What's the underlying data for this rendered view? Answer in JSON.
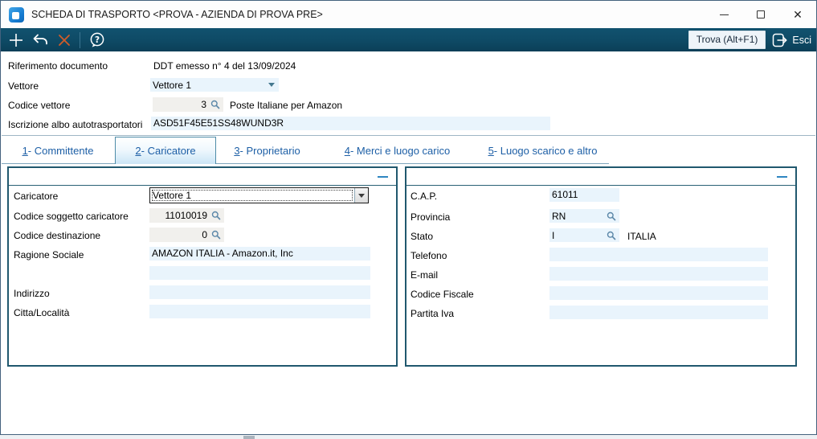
{
  "window": {
    "title": "SCHEDA DI TRASPORTO <PROVA - AZIENDA DI PROVA PRE>"
  },
  "toolbar": {
    "trova_label": "Trova (Alt+F1)",
    "esci_label": "Esci"
  },
  "header": {
    "riferimento": {
      "label": "Riferimento documento",
      "value": "DDT emesso n° 4 del 13/09/2024"
    },
    "vettore": {
      "label": "Vettore",
      "value": "Vettore 1"
    },
    "codice_vettore": {
      "label": "Codice vettore",
      "value": "3",
      "desc": "Poste Italiane per Amazon"
    },
    "iscrizione": {
      "label": "Iscrizione albo autotrasportatori",
      "value": "ASD51F45E51SS48WUND3R"
    }
  },
  "tabs": [
    {
      "num": "1",
      "rest": " - Committente"
    },
    {
      "num": "2",
      "rest": " - Caricatore"
    },
    {
      "num": "3",
      "rest": " - Proprietario"
    },
    {
      "num": "4",
      "rest": " - Merci e luogo carico"
    },
    {
      "num": "5",
      "rest": " - Luogo scarico e altro"
    }
  ],
  "caricatore_panel": {
    "caricatore": {
      "label": "Caricatore",
      "value": "Vettore 1"
    },
    "codice_soggetto": {
      "label": "Codice soggetto caricatore",
      "value": "11010019"
    },
    "codice_destinazione": {
      "label": "Codice destinazione",
      "value": "0"
    },
    "ragione_sociale": {
      "label": "Ragione Sociale",
      "value": "AMAZON ITALIA - Amazon.it, Inc",
      "value2": ""
    },
    "indirizzo": {
      "label": "Indirizzo",
      "value": ""
    },
    "citta": {
      "label": "Citta/Località",
      "value": ""
    }
  },
  "dettagli_panel": {
    "cap": {
      "label": "C.A.P.",
      "value": "61011"
    },
    "provincia": {
      "label": "Provincia",
      "value": "RN"
    },
    "stato": {
      "label": "Stato",
      "value": "I",
      "desc": "ITALIA"
    },
    "telefono": {
      "label": "Telefono",
      "value": ""
    },
    "email": {
      "label": "E-mail",
      "value": ""
    },
    "codice_fiscale": {
      "label": "Codice Fiscale",
      "value": ""
    },
    "partita_iva": {
      "label": "Partita Iva",
      "value": ""
    }
  },
  "colors": {
    "toolbar_teal": "#0e4a65",
    "accent_orange": "#d15c28",
    "field_blue": "#e9f4fc",
    "tab_text_blue": "#1d5fa6",
    "panel_border": "#20586e",
    "collapse_blue": "#2e86c1"
  }
}
